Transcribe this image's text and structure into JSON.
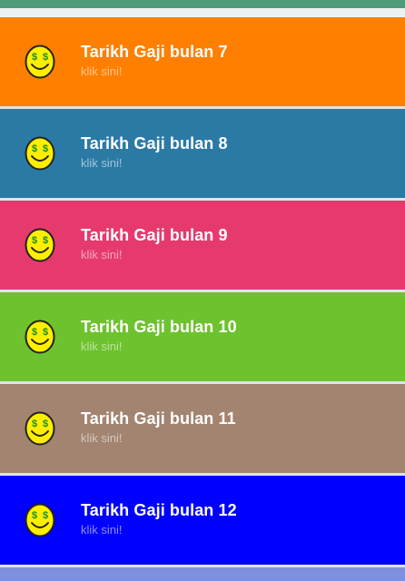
{
  "list": {
    "items": [
      {
        "title": "Tarikh Gaji bulan 7",
        "subtitle": "klik sini!",
        "color": "#ff7f00"
      },
      {
        "title": "Tarikh Gaji bulan 8",
        "subtitle": "klik sini!",
        "color": "#2b7aa6"
      },
      {
        "title": "Tarikh Gaji bulan 9",
        "subtitle": "klik sini!",
        "color": "#e63a6f"
      },
      {
        "title": "Tarikh Gaji bulan 10",
        "subtitle": "klik sini!",
        "color": "#6ec22e"
      },
      {
        "title": "Tarikh Gaji bulan 11",
        "subtitle": "klik sini!",
        "color": "#a28471"
      },
      {
        "title": "Tarikh Gaji bulan 12",
        "subtitle": "klik sini!",
        "color": "#0000ff"
      }
    ],
    "icon": "money-smiley-icon",
    "next_item_color": "#7f8fe0"
  },
  "theme": {
    "top_strip_color": "#4f9b79",
    "icon_face_color": "#ffee00",
    "icon_outline_color": "#222222",
    "icon_symbol_color": "#1a8f2a"
  }
}
